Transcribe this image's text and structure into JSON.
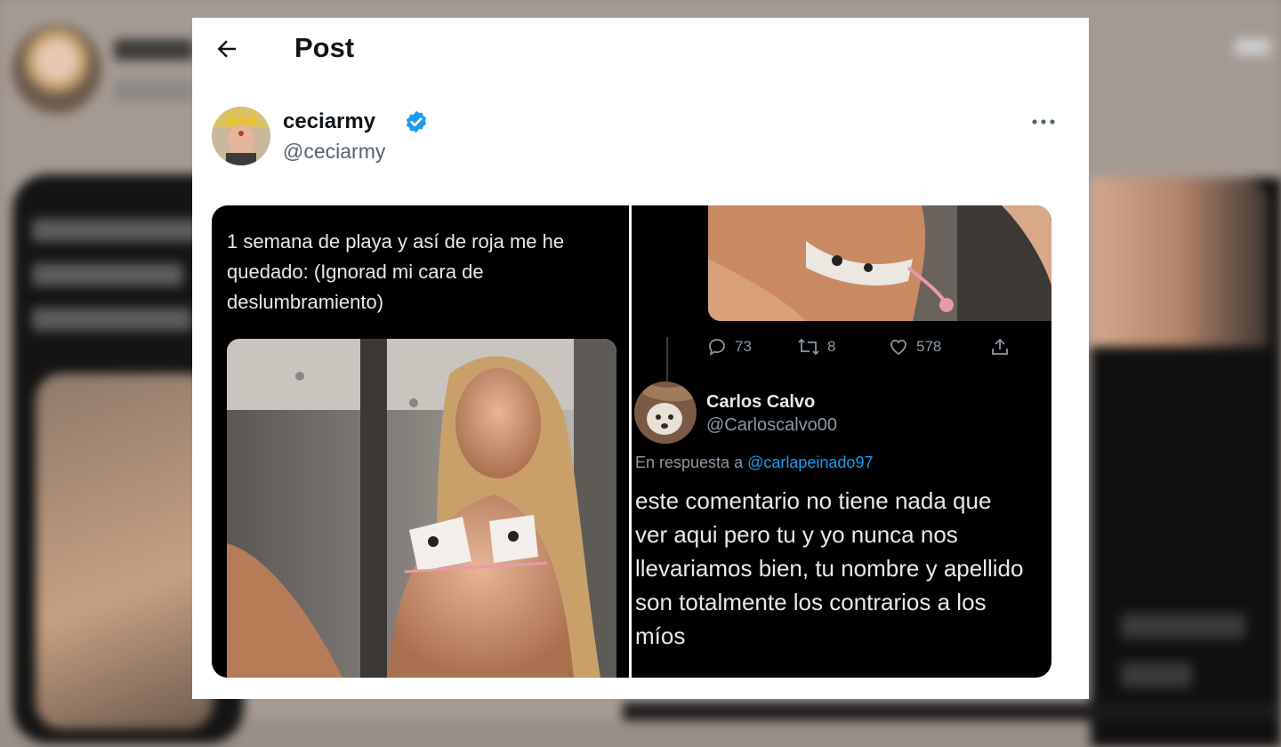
{
  "page": {
    "title": "Post"
  },
  "author": {
    "display_name": "ceciarmy",
    "handle": "@ceciarmy",
    "verified": true,
    "verified_color": "#1d9bf0"
  },
  "embedded_tweet": {
    "text": "1 semana de playa y así de roja me he quedado: (Ignorad mi cara de deslumbramiento)",
    "stats": {
      "replies": "73",
      "retweets": "8",
      "likes": "578"
    }
  },
  "reply": {
    "display_name": "Carlos Calvo",
    "handle": "@Carloscalvo00",
    "in_reply_prefix": "En respuesta a ",
    "in_reply_mention": "@carlapeinado97",
    "text_lines": [
      "este comentario no tiene nada que",
      "ver aqui pero tu y yo nunca nos",
      "llevariamos bien, tu nombre y apellido",
      "son totalmente los contrarios a los",
      "míos"
    ]
  },
  "icons": {
    "back": "arrow-left-icon",
    "more": "more-horizontal-icon",
    "verified": "verified-badge-icon",
    "reply": "reply-icon",
    "retweet": "retweet-icon",
    "like": "heart-icon",
    "share": "share-icon"
  },
  "colors": {
    "text_primary": "#0f1419",
    "text_secondary": "#536471",
    "dark_bg": "#000000",
    "dark_text": "#e7e9ea",
    "dark_muted": "#8b98a5",
    "link": "#1d9bf0"
  }
}
